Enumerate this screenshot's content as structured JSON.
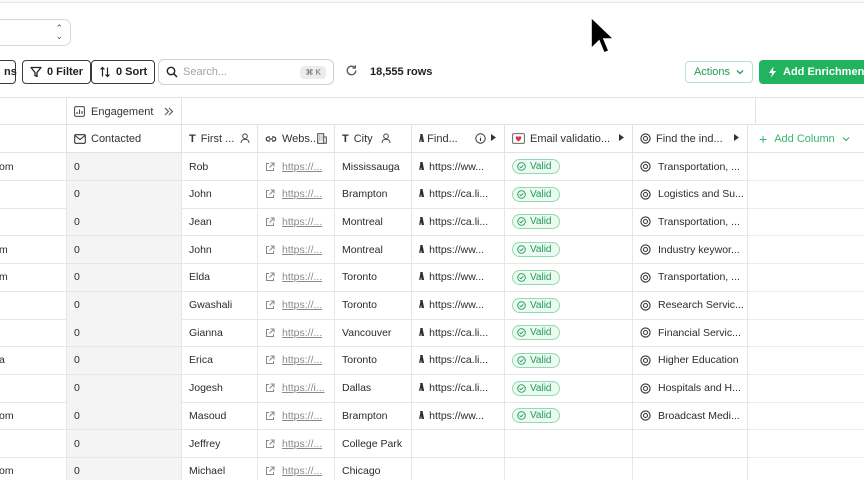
{
  "toolbar": {
    "partial_left_label": "ns",
    "filter_label": "0 Filter",
    "sort_label": "0 Sort",
    "search_placeholder": "Search...",
    "search_shortcut": "⌘ K",
    "row_count": "18,555 rows",
    "actions_label": "Actions",
    "add_enrichment_label": "Add Enrichment"
  },
  "group_header": {
    "engagement_label": "Engagement",
    "collapse_icon": "double-chevron-right-icon"
  },
  "columns": {
    "contacted": "Contacted",
    "first_name": "First ...",
    "website": "Webs...",
    "city": "City",
    "find": "Find...",
    "email_validation": "Email validatio...",
    "find_industry": "Find the ind...",
    "add_column": "Add Column"
  },
  "rows": [
    {
      "partial": "om",
      "contacted": "0",
      "first": "Rob",
      "website": "https://...",
      "city": "Mississauga",
      "find": "https://ww...",
      "valid": "Valid",
      "industry": "Transportation, ..."
    },
    {
      "partial": "",
      "contacted": "0",
      "first": "John",
      "website": "https://...",
      "city": "Brampton",
      "find": "https://ca.li...",
      "valid": "Valid",
      "industry": "Logistics and Su..."
    },
    {
      "partial": "",
      "contacted": "0",
      "first": "Jean",
      "website": "https://...",
      "city": "Montreal",
      "find": "https://ca.li...",
      "valid": "Valid",
      "industry": "Transportation, ..."
    },
    {
      "partial": "m",
      "contacted": "0",
      "first": "John",
      "website": "https://...",
      "city": "Montreal",
      "find": "https://ww...",
      "valid": "Valid",
      "industry": "Industry keywor..."
    },
    {
      "partial": "m",
      "contacted": "0",
      "first": "Elda",
      "website": "https://...",
      "city": "Toronto",
      "find": "https://ww...",
      "valid": "Valid",
      "industry": "Transportation, ..."
    },
    {
      "partial": "",
      "contacted": "0",
      "first": "Gwashali",
      "website": "https://...",
      "city": "Toronto",
      "find": "https://ww...",
      "valid": "Valid",
      "industry": "Research Servic..."
    },
    {
      "partial": "",
      "contacted": "0",
      "first": "Gianna",
      "website": "https://...",
      "city": "Vancouver",
      "find": "https://ca.li...",
      "valid": "Valid",
      "industry": "Financial Servic..."
    },
    {
      "partial": "a",
      "contacted": "0",
      "first": "Erica",
      "website": "https://...",
      "city": "Toronto",
      "find": "https://ca.li...",
      "valid": "Valid",
      "industry": "Higher Education"
    },
    {
      "partial": "",
      "contacted": "0",
      "first": "Jogesh",
      "website": "https://i...",
      "city": "Dallas",
      "find": "https://ca.li...",
      "valid": "Valid",
      "industry": "Hospitals and H..."
    },
    {
      "partial": "om",
      "contacted": "0",
      "first": "Masoud",
      "website": "https://...",
      "city": "Brampton",
      "find": "https://ww...",
      "valid": "Valid",
      "industry": "Broadcast Medi..."
    },
    {
      "partial": "",
      "contacted": "0",
      "first": "Jeffrey",
      "website": "https://...",
      "city": "College Park",
      "find": "",
      "valid": "",
      "industry": ""
    },
    {
      "partial": "om",
      "contacted": "0",
      "first": "Michael",
      "website": "https://...",
      "city": "Chicago",
      "find": "",
      "valid": "",
      "industry": ""
    }
  ],
  "colors": {
    "accent_green": "#22b35e",
    "valid_green": "#1d9c55",
    "border": "#e3e3e3"
  }
}
